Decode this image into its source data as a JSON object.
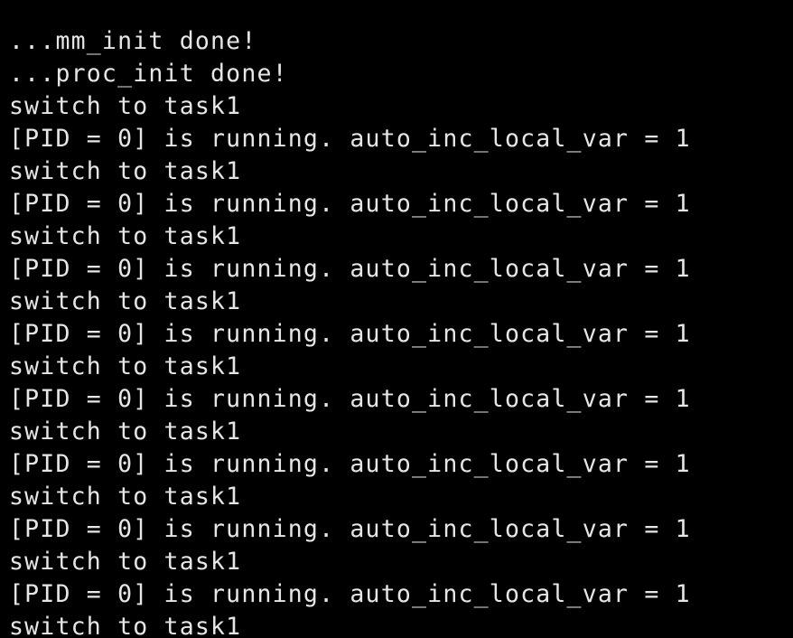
{
  "terminal": {
    "background": "#000000",
    "foreground": "#e6e6e6",
    "lines": [
      "...mm_init done!",
      "...proc_init done!",
      "switch to task1",
      "[PID = 0] is running. auto_inc_local_var = 1",
      "switch to task1",
      "[PID = 0] is running. auto_inc_local_var = 1",
      "switch to task1",
      "[PID = 0] is running. auto_inc_local_var = 1",
      "switch to task1",
      "[PID = 0] is running. auto_inc_local_var = 1",
      "switch to task1",
      "[PID = 0] is running. auto_inc_local_var = 1",
      "switch to task1",
      "[PID = 0] is running. auto_inc_local_var = 1",
      "switch to task1",
      "[PID = 0] is running. auto_inc_local_var = 1",
      "switch to task1",
      "[PID = 0] is running. auto_inc_local_var = 1",
      "switch to task1"
    ]
  }
}
